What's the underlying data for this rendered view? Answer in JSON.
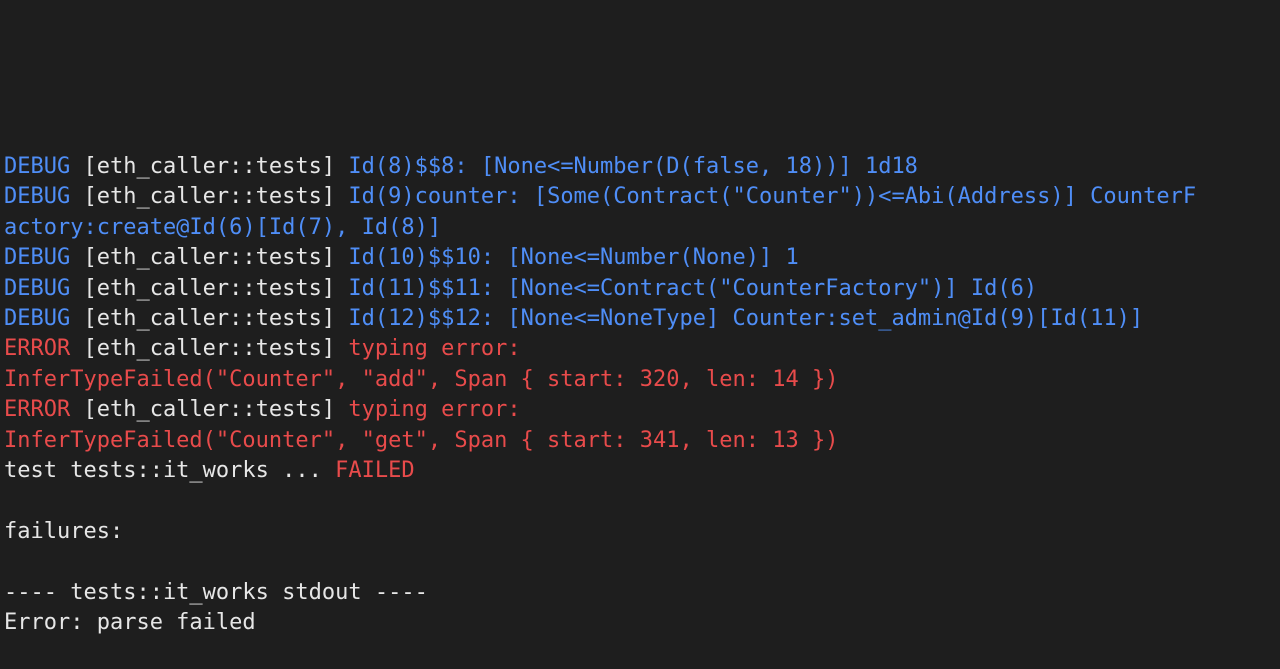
{
  "terminal": {
    "lines": [
      {
        "segments": [
          {
            "kind": "dbg",
            "text": "DEBUG"
          },
          {
            "kind": "plain",
            "text": " [eth_caller::tests] "
          },
          {
            "kind": "dbg",
            "text": "Id(8)$$8: [None<=Number(D(false, 18))] 1d18"
          }
        ]
      },
      {
        "segments": [
          {
            "kind": "dbg",
            "text": "DEBUG"
          },
          {
            "kind": "plain",
            "text": " [eth_caller::tests] "
          },
          {
            "kind": "dbg",
            "text": "Id(9)counter: [Some(Contract(\"Counter\"))<=Abi(Address)] CounterF"
          }
        ]
      },
      {
        "segments": [
          {
            "kind": "dbg",
            "text": "actory:create@Id(6)[Id(7), Id(8)]"
          }
        ]
      },
      {
        "segments": [
          {
            "kind": "dbg",
            "text": "DEBUG"
          },
          {
            "kind": "plain",
            "text": " [eth_caller::tests] "
          },
          {
            "kind": "dbg",
            "text": "Id(10)$$10: [None<=Number(None)] 1"
          }
        ]
      },
      {
        "segments": [
          {
            "kind": "dbg",
            "text": "DEBUG"
          },
          {
            "kind": "plain",
            "text": " [eth_caller::tests] "
          },
          {
            "kind": "dbg",
            "text": "Id(11)$$11: [None<=Contract(\"CounterFactory\")] Id(6)"
          }
        ]
      },
      {
        "segments": [
          {
            "kind": "dbg",
            "text": "DEBUG"
          },
          {
            "kind": "plain",
            "text": " [eth_caller::tests] "
          },
          {
            "kind": "dbg",
            "text": "Id(12)$$12: [None<=NoneType] Counter:set_admin@Id(9)[Id(11)]"
          }
        ]
      },
      {
        "segments": [
          {
            "kind": "err",
            "text": "ERROR"
          },
          {
            "kind": "plain",
            "text": " [eth_caller::tests] "
          },
          {
            "kind": "err",
            "text": "typing error:"
          }
        ]
      },
      {
        "segments": [
          {
            "kind": "err",
            "text": "InferTypeFailed(\"Counter\", \"add\", Span { start: 320, len: 14 })"
          }
        ]
      },
      {
        "segments": [
          {
            "kind": "err",
            "text": "ERROR"
          },
          {
            "kind": "plain",
            "text": " [eth_caller::tests] "
          },
          {
            "kind": "err",
            "text": "typing error:"
          }
        ]
      },
      {
        "segments": [
          {
            "kind": "err",
            "text": "InferTypeFailed(\"Counter\", \"get\", Span { start: 341, len: 13 })"
          }
        ]
      },
      {
        "segments": [
          {
            "kind": "plain",
            "text": "test tests::it_works ... "
          },
          {
            "kind": "err",
            "text": "FAILED"
          }
        ]
      },
      {
        "segments": [
          {
            "kind": "plain",
            "text": ""
          }
        ]
      },
      {
        "segments": [
          {
            "kind": "plain",
            "text": "failures:"
          }
        ]
      },
      {
        "segments": [
          {
            "kind": "plain",
            "text": ""
          }
        ]
      },
      {
        "segments": [
          {
            "kind": "plain",
            "text": "---- tests::it_works stdout ----"
          }
        ]
      },
      {
        "segments": [
          {
            "kind": "plain",
            "text": "Error: parse failed"
          }
        ]
      }
    ]
  },
  "colors": {
    "background": "#1e1e1e",
    "debug": "#4f8ef7",
    "error": "#e84b4b",
    "text": "#e6e6e6"
  }
}
